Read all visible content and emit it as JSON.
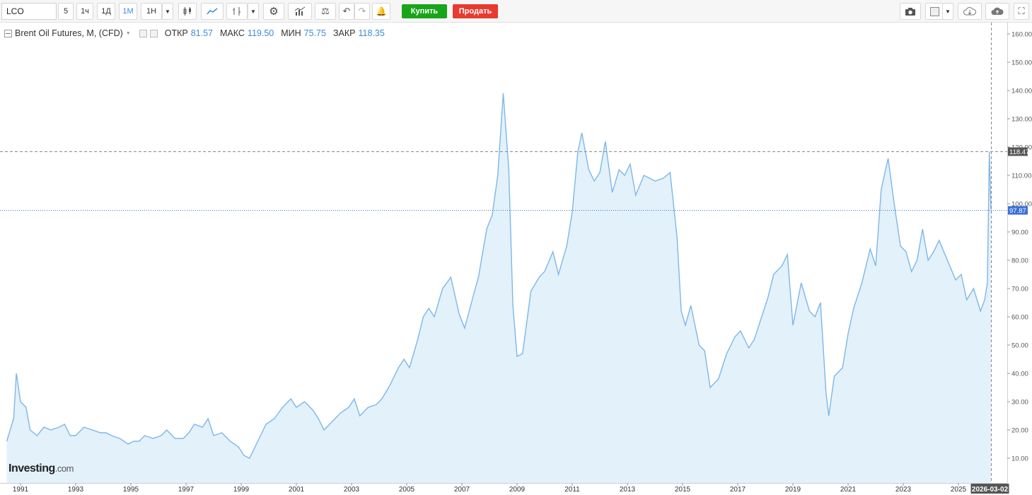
{
  "toolbar": {
    "symbol": "LCO",
    "timeframes": [
      "5",
      "1ч",
      "1Д",
      "1М",
      "1Н"
    ],
    "active_timeframe": "1М",
    "buy_label": "Купить",
    "sell_label": "Продать"
  },
  "legend": {
    "title": "Brent Oil Futures, M, (CFD)",
    "open_label": "ОТКР",
    "open_value": "81.57",
    "high_label": "МАКС",
    "high_value": "119.50",
    "low_label": "МИН",
    "low_value": "75.75",
    "close_label": "ЗАКР",
    "close_value": "118.35"
  },
  "watermark": {
    "brand": "Investing",
    "domain": ".com"
  },
  "colors": {
    "line": "#7db7e8",
    "fill": "#e3f1fb",
    "accent": "#3b8bd9",
    "buy": "#19a519",
    "sell": "#e83a2f",
    "hline_dark": "#555555",
    "hline_blue": "#3b6fd9"
  },
  "chart_data": {
    "type": "area",
    "title": "Brent Oil Futures, M, (CFD)",
    "ylim": [
      0,
      165
    ],
    "y_ticks": [
      "10.00",
      "20.00",
      "30.00",
      "40.00",
      "50.00",
      "60.00",
      "70.00",
      "80.00",
      "90.00",
      "100.00",
      "110.00",
      "120.00",
      "130.00",
      "140.00",
      "150.00",
      "160.00"
    ],
    "x_ticks": [
      "1991",
      "1993",
      "1995",
      "1997",
      "1999",
      "2001",
      "2003",
      "2005",
      "2007",
      "2009",
      "2011",
      "2013",
      "2015",
      "2017",
      "2019",
      "2021",
      "2023",
      "2025"
    ],
    "cursor_date_label": "2026-03-02",
    "price_markers": [
      {
        "value": 118.47,
        "label": "118.47",
        "style": "dashed-dark"
      },
      {
        "value": 97.87,
        "label": "97.87",
        "style": "dotted-blue"
      }
    ],
    "series": [
      {
        "points": [
          [
            1990.5,
            16
          ],
          [
            1990.75,
            24
          ],
          [
            1990.85,
            40
          ],
          [
            1991.0,
            30
          ],
          [
            1991.2,
            28
          ],
          [
            1991.35,
            20
          ],
          [
            1991.6,
            18
          ],
          [
            1991.85,
            21
          ],
          [
            1992.1,
            20
          ],
          [
            1992.4,
            21
          ],
          [
            1992.6,
            22
          ],
          [
            1992.8,
            18
          ],
          [
            1993.0,
            18
          ],
          [
            1993.3,
            21
          ],
          [
            1993.6,
            20
          ],
          [
            1993.9,
            19
          ],
          [
            1994.1,
            19
          ],
          [
            1994.3,
            18
          ],
          [
            1994.6,
            17
          ],
          [
            1994.9,
            15
          ],
          [
            1995.1,
            16
          ],
          [
            1995.3,
            16
          ],
          [
            1995.5,
            18
          ],
          [
            1995.8,
            17
          ],
          [
            1996.1,
            18
          ],
          [
            1996.3,
            20
          ],
          [
            1996.6,
            17
          ],
          [
            1996.9,
            17
          ],
          [
            1997.1,
            19
          ],
          [
            1997.3,
            22
          ],
          [
            1997.6,
            21
          ],
          [
            1997.8,
            24
          ],
          [
            1998.0,
            18
          ],
          [
            1998.3,
            19
          ],
          [
            1998.6,
            16
          ],
          [
            1998.9,
            14
          ],
          [
            1999.1,
            11
          ],
          [
            1999.3,
            10
          ],
          [
            1999.6,
            16
          ],
          [
            1999.9,
            22
          ],
          [
            2000.2,
            24
          ],
          [
            2000.5,
            28
          ],
          [
            2000.8,
            31
          ],
          [
            2001.0,
            28
          ],
          [
            2001.3,
            30
          ],
          [
            2001.6,
            27
          ],
          [
            2001.8,
            24
          ],
          [
            2002.0,
            20
          ],
          [
            2002.3,
            23
          ],
          [
            2002.6,
            26
          ],
          [
            2002.9,
            28
          ],
          [
            2003.1,
            31
          ],
          [
            2003.3,
            25
          ],
          [
            2003.6,
            28
          ],
          [
            2003.9,
            29
          ],
          [
            2004.1,
            31
          ],
          [
            2004.4,
            36
          ],
          [
            2004.7,
            42
          ],
          [
            2004.9,
            45
          ],
          [
            2005.1,
            42
          ],
          [
            2005.4,
            52
          ],
          [
            2005.6,
            60
          ],
          [
            2005.8,
            63
          ],
          [
            2006.0,
            60
          ],
          [
            2006.3,
            70
          ],
          [
            2006.6,
            74
          ],
          [
            2006.9,
            61
          ],
          [
            2007.1,
            56
          ],
          [
            2007.4,
            67
          ],
          [
            2007.6,
            74
          ],
          [
            2007.9,
            91
          ],
          [
            2008.1,
            96
          ],
          [
            2008.3,
            110
          ],
          [
            2008.5,
            139
          ],
          [
            2008.7,
            112
          ],
          [
            2008.85,
            64
          ],
          [
            2009.0,
            46
          ],
          [
            2009.2,
            47
          ],
          [
            2009.5,
            69
          ],
          [
            2009.8,
            74
          ],
          [
            2010.0,
            76
          ],
          [
            2010.3,
            83
          ],
          [
            2010.5,
            75
          ],
          [
            2010.8,
            85
          ],
          [
            2011.0,
            97
          ],
          [
            2011.2,
            118
          ],
          [
            2011.35,
            125
          ],
          [
            2011.6,
            112
          ],
          [
            2011.8,
            108
          ],
          [
            2012.0,
            111
          ],
          [
            2012.2,
            122
          ],
          [
            2012.45,
            104
          ],
          [
            2012.7,
            112
          ],
          [
            2012.9,
            110
          ],
          [
            2013.1,
            114
          ],
          [
            2013.3,
            103
          ],
          [
            2013.6,
            110
          ],
          [
            2013.8,
            109
          ],
          [
            2014.0,
            108
          ],
          [
            2014.3,
            109
          ],
          [
            2014.55,
            111
          ],
          [
            2014.8,
            88
          ],
          [
            2014.95,
            62
          ],
          [
            2015.1,
            57
          ],
          [
            2015.3,
            64
          ],
          [
            2015.6,
            50
          ],
          [
            2015.8,
            48
          ],
          [
            2016.0,
            35
          ],
          [
            2016.3,
            38
          ],
          [
            2016.6,
            47
          ],
          [
            2016.9,
            53
          ],
          [
            2017.1,
            55
          ],
          [
            2017.4,
            49
          ],
          [
            2017.6,
            52
          ],
          [
            2017.9,
            61
          ],
          [
            2018.1,
            67
          ],
          [
            2018.3,
            75
          ],
          [
            2018.6,
            78
          ],
          [
            2018.8,
            82
          ],
          [
            2019.0,
            57
          ],
          [
            2019.3,
            72
          ],
          [
            2019.6,
            62
          ],
          [
            2019.8,
            60
          ],
          [
            2020.0,
            65
          ],
          [
            2020.2,
            33
          ],
          [
            2020.3,
            25
          ],
          [
            2020.5,
            39
          ],
          [
            2020.8,
            42
          ],
          [
            2021.0,
            54
          ],
          [
            2021.2,
            63
          ],
          [
            2021.5,
            72
          ],
          [
            2021.8,
            84
          ],
          [
            2022.0,
            78
          ],
          [
            2022.2,
            105
          ],
          [
            2022.45,
            116
          ],
          [
            2022.7,
            98
          ],
          [
            2022.9,
            85
          ],
          [
            2023.1,
            83
          ],
          [
            2023.3,
            76
          ],
          [
            2023.5,
            80
          ],
          [
            2023.7,
            91
          ],
          [
            2023.9,
            80
          ],
          [
            2024.1,
            83
          ],
          [
            2024.3,
            87
          ],
          [
            2024.6,
            80
          ],
          [
            2024.9,
            73
          ],
          [
            2025.1,
            75
          ],
          [
            2025.3,
            66
          ],
          [
            2025.55,
            70
          ],
          [
            2025.8,
            62
          ],
          [
            2025.95,
            66
          ],
          [
            2026.05,
            72
          ],
          [
            2026.12,
            118.35
          ],
          [
            2026.18,
            97.87
          ]
        ]
      }
    ]
  }
}
